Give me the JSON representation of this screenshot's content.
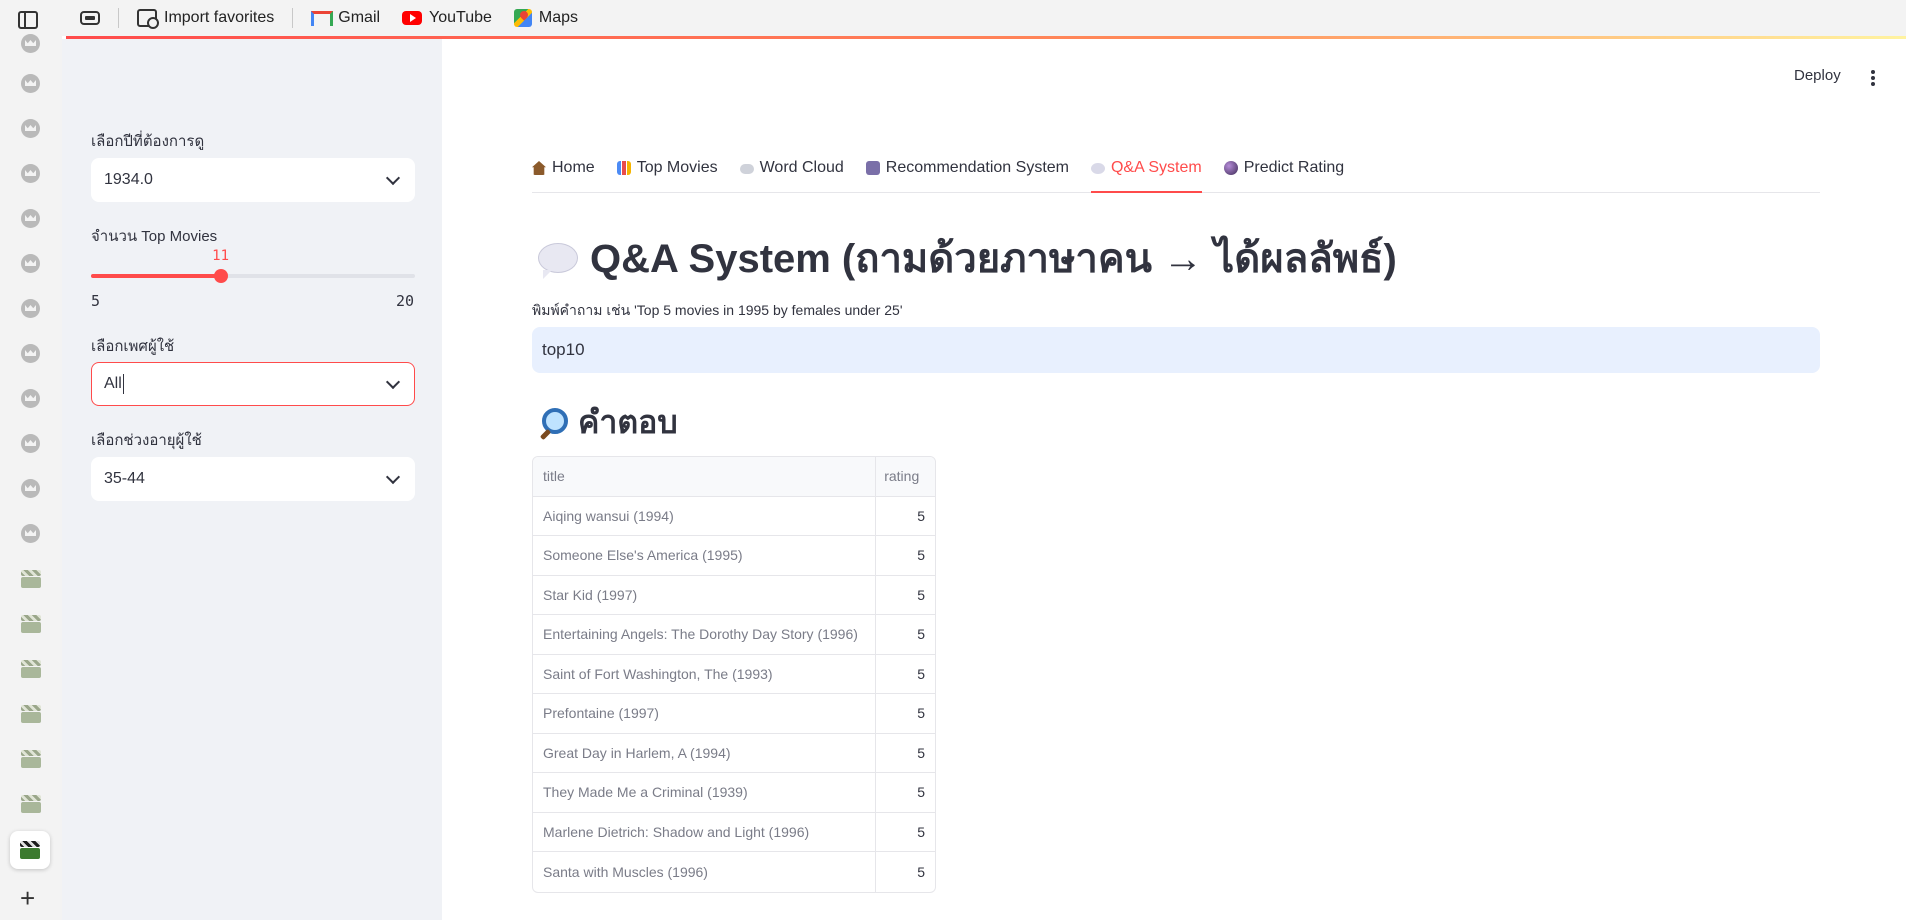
{
  "browser": {
    "bookmarks": [
      {
        "label": "Import favorites",
        "icon": "import-icon"
      },
      {
        "label": "Gmail",
        "icon": "gmail-icon"
      },
      {
        "label": "YouTube",
        "icon": "youtube-icon"
      },
      {
        "label": "Maps",
        "icon": "maps-icon"
      }
    ]
  },
  "sidebar": {
    "year_label": "เลือกปีที่ต้องการดู",
    "year_value": "1934.0",
    "top_movies_label": "จำนวน Top Movies",
    "slider": {
      "value": "11",
      "min": "5",
      "max": "20",
      "value_num": 11,
      "min_num": 5,
      "max_num": 20
    },
    "gender_label": "เลือกเพศผู้ใช้",
    "gender_value": "All",
    "age_label": "เลือกช่วงอายุผู้ใช้",
    "age_value": "35-44"
  },
  "header": {
    "deploy_label": "Deploy"
  },
  "tabs": [
    {
      "label": "Home",
      "icon": "home-icon"
    },
    {
      "label": "Top Movies",
      "icon": "bar-chart-icon"
    },
    {
      "label": "Word Cloud",
      "icon": "cloud-icon"
    },
    {
      "label": "Recommendation System",
      "icon": "robot-icon"
    },
    {
      "label": "Q&A System",
      "icon": "speech-bubble-icon",
      "active": true
    },
    {
      "label": "Predict Rating",
      "icon": "crystal-ball-icon"
    }
  ],
  "main": {
    "title": "Q&A System (ถามด้วยภาษาคน → ได้ผลลัพธ์)",
    "question_label": "พิมพ์คำถาม เช่น 'Top 5 movies in 1995 by females under 25'",
    "question_value": "top10",
    "answer_heading": "คำตอบ"
  },
  "table": {
    "columns": [
      "title",
      "rating"
    ],
    "rows": [
      {
        "title": "Aiqing wansui (1994)",
        "rating": "5"
      },
      {
        "title": "Someone Else's America (1995)",
        "rating": "5"
      },
      {
        "title": "Star Kid (1997)",
        "rating": "5"
      },
      {
        "title": "Entertaining Angels: The Dorothy Day Story (1996)",
        "rating": "5"
      },
      {
        "title": "Saint of Fort Washington, The (1993)",
        "rating": "5"
      },
      {
        "title": "Prefontaine (1997)",
        "rating": "5"
      },
      {
        "title": "Great Day in Harlem, A (1994)",
        "rating": "5"
      },
      {
        "title": "They Made Me a Criminal (1939)",
        "rating": "5"
      },
      {
        "title": "Marlene Dietrich: Shadow and Light (1996)",
        "rating": "5"
      },
      {
        "title": "Santa with Muscles (1996)",
        "rating": "5"
      }
    ]
  },
  "colors": {
    "accent": "#ff4b4b",
    "sidebar_bg": "#f0f2f6",
    "input_bg": "#e8f0fe"
  }
}
